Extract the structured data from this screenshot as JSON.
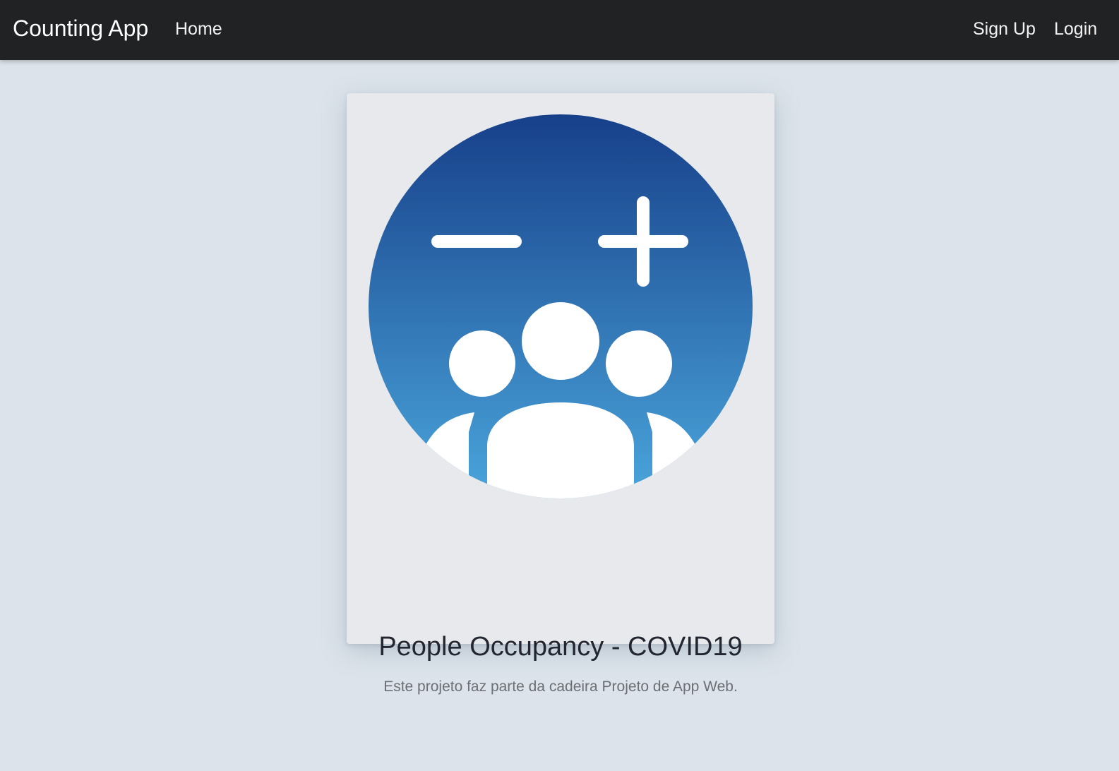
{
  "navbar": {
    "brand": "Counting App",
    "links": [
      {
        "label": "Home"
      },
      {
        "label": "Sign Up"
      },
      {
        "label": "Login"
      }
    ]
  },
  "card": {
    "image": {
      "icon": "people-counter-icon",
      "gradient_top": "#17408a",
      "gradient_bottom": "#4aa5db"
    },
    "title": "People Occupancy - COVID19",
    "text": "Este projeto faz parte da cadeira Projeto de App Web."
  },
  "colors": {
    "navbar_bg": "#212224",
    "page_bg": "#dce3ea",
    "card_bg": "#e7e9ec"
  }
}
